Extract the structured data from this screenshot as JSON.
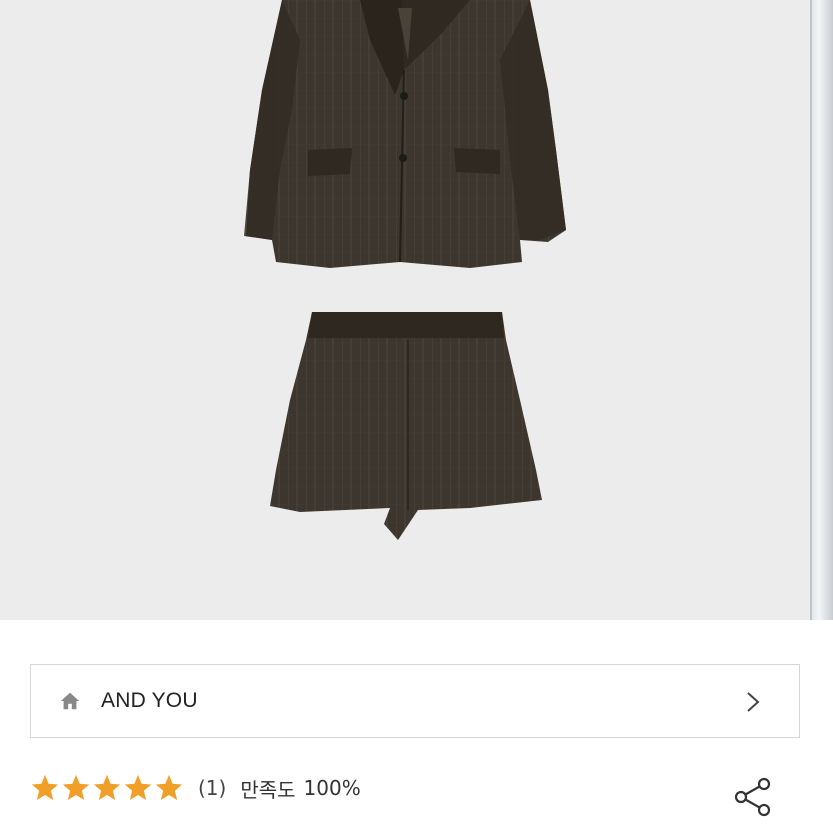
{
  "product": {
    "image_alt": "Brown check wool blazer and shorts set",
    "colors": {
      "fabric": "#3b342c",
      "fabric_dark": "#2a241d",
      "background": "#ececec"
    }
  },
  "shop": {
    "icon": "home-icon",
    "name": "AND YOU",
    "chevron_icon": "chevron-right-icon"
  },
  "rating": {
    "stars": 5,
    "max_stars": 5,
    "star_color": "#f0a028",
    "review_count": "(1)",
    "satisfaction_label": "만족도",
    "satisfaction_value": "100%"
  },
  "actions": {
    "share_icon": "share-icon"
  }
}
